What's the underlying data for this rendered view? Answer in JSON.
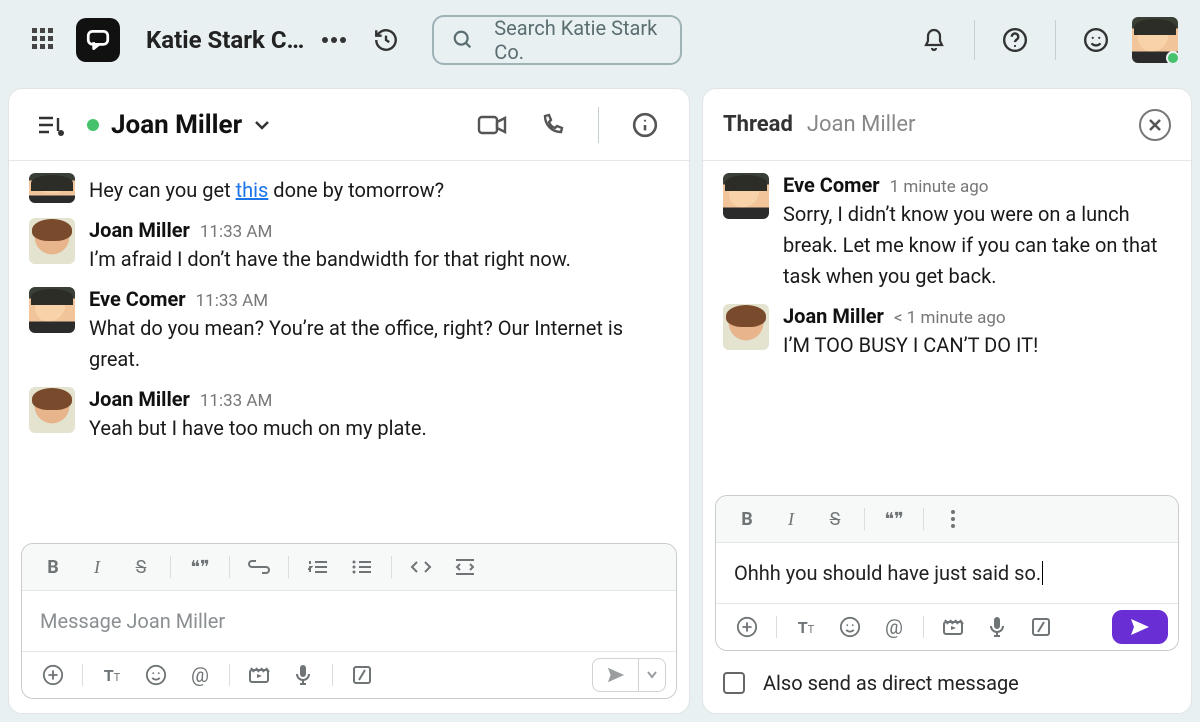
{
  "workspace_name": "Katie Stark C…",
  "search_placeholder": "Search Katie Stark Co.",
  "chat": {
    "title": "Joan Miller",
    "messages": [
      {
        "sender": null,
        "time": null,
        "avatar": "eve",
        "partial": true,
        "parts": [
          {
            "t": "Hey can you get "
          },
          {
            "t": "this",
            "link": true
          },
          {
            "t": " done by tomorrow?"
          }
        ]
      },
      {
        "sender": "Joan Miller",
        "time": "11:33 AM",
        "avatar": "joan",
        "text": "I’m afraid I don’t have the bandwidth for that right now."
      },
      {
        "sender": "Eve Comer",
        "time": "11:33 AM",
        "avatar": "eve",
        "text": "What do you mean? You’re at the office, right? Our Internet is great."
      },
      {
        "sender": "Joan Miller",
        "time": "11:33 AM",
        "avatar": "joan",
        "text": "Yeah but I have too much on my plate."
      }
    ],
    "compose_placeholder": "Message Joan Miller"
  },
  "thread": {
    "title": "Thread",
    "subtitle": "Joan Miller",
    "messages": [
      {
        "sender": "Eve Comer",
        "time": "1 minute ago",
        "avatar": "eve",
        "text": "Sorry, I didn’t know you were on a lunch break. Let me know if you can take on that task when you get back."
      },
      {
        "sender": "Joan Miller",
        "time": "< 1 minute ago",
        "avatar": "joan",
        "text": "I’M TOO BUSY I CAN’T DO IT!"
      }
    ],
    "compose_value": "Ohhh you should have just said so.",
    "also_send_label": "Also send as direct message"
  }
}
